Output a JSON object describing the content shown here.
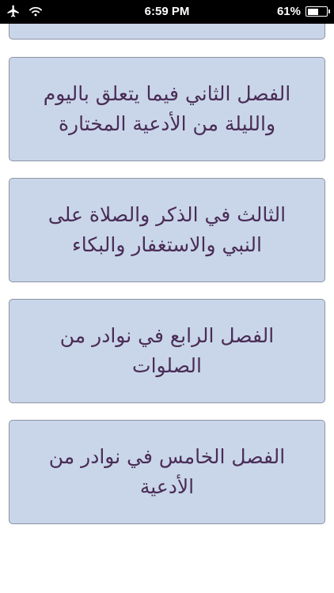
{
  "status_bar": {
    "time": "6:59 PM",
    "battery_percent": "61%",
    "battery_level": 0.61,
    "icons": [
      "airplane-icon",
      "wifi-icon",
      "battery-icon"
    ]
  },
  "chapters": [
    {
      "title": ""
    },
    {
      "title": "الفصل الثاني فيما يتعلق باليوم والليلة من الأدعية المختارة"
    },
    {
      "title": "الثالث في الذكر والصلاة على النبي والاستغفار والبكاء"
    },
    {
      "title": "الفصل الرابع في نوادر من الصلوات"
    },
    {
      "title": "الفصل الخامس في نوادر من الأدعية"
    }
  ],
  "colors": {
    "card_background": "#c9d6ea",
    "card_border": "#8d94a4",
    "title_text": "#4a2c56",
    "status_bar": "#000000"
  }
}
